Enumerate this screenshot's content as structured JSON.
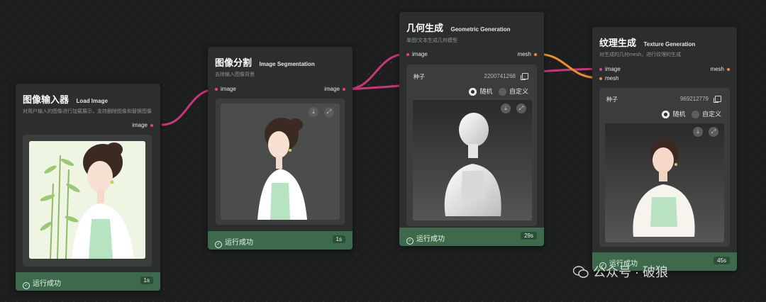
{
  "nodes": {
    "load": {
      "title_zh": "图像输入器",
      "title_en": "Load Image",
      "desc": "对用户输入的图像进行加载展示，支持删除图像和替换图像",
      "out_port": "image",
      "status": "运行成功",
      "duration": "1s"
    },
    "seg": {
      "title_zh": "图像分割",
      "title_en": "Image Segmentation",
      "desc": "去除输入图像背景",
      "in_port": "image",
      "out_port": "image",
      "status": "运行成功",
      "duration": "1s"
    },
    "geo": {
      "title_zh": "几何生成",
      "title_en": "Geometric Generation",
      "desc": "单图/文本生成几何模型",
      "in_port": "image",
      "out_port": "mesh",
      "seed_label": "种子",
      "seed_value": "2200741268",
      "radio_random": "随机",
      "radio_custom": "自定义",
      "status": "运行成功",
      "duration": "29s"
    },
    "tex": {
      "title_zh": "纹理生成",
      "title_en": "Texture Generation",
      "desc": "对生成的几何mesh，进行纹理的生成",
      "in_port_image": "image",
      "in_port_mesh": "mesh",
      "out_port": "mesh",
      "seed_label": "种子",
      "seed_value": "969212779",
      "radio_random": "随机",
      "radio_custom": "自定义",
      "status": "运行成功",
      "duration": "45s"
    }
  },
  "watermark": "公众号 · 破狼",
  "colors": {
    "image_wire": "#c8357a",
    "mesh_wire": "#ef8d2c",
    "status_bar": "#3d6a4c",
    "node_bg": "#2b2e2c"
  },
  "icons": {
    "download": "download-icon",
    "expand": "expand-icon",
    "copy": "copy-icon",
    "check": "check-circle-icon"
  }
}
